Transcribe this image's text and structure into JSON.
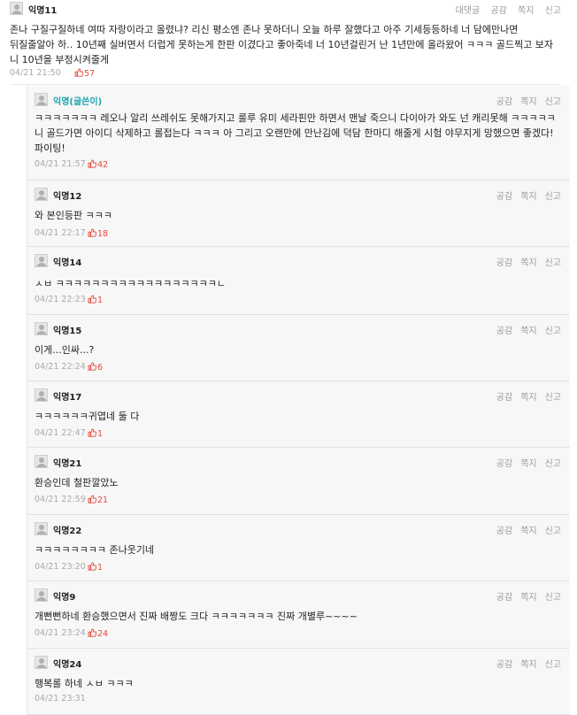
{
  "top_comment": {
    "author": "익명11",
    "actions": [
      "대댓글",
      "공감",
      "쪽지",
      "신고"
    ],
    "text": "존나 구질구질하네 여따 자랑이라고 올렸냐? 리신 평소엔 존나 못하더니 오늘 하루 잘했다고 아주 기세등등하네 너 담에만나면 뒤질줄알아 하.. 10년째 실버면서 더럽게 못하는게 한판 이겼다고 좋아죽네 너 10년걸린거 난 1년만에 올라왔어 ㅋㅋㅋ 골드찍고 보자 니 10년을 부정시켜줄게",
    "time": "04/21 21:50",
    "likes": "57"
  },
  "reply_actions": [
    "공감",
    "쪽지",
    "신고"
  ],
  "replies": [
    {
      "author": "익명(글쓴이)",
      "is_op": true,
      "text": "ㅋㅋㅋㅋㅋㅋㅋ 레오나 알리 쓰레쉬도 못해가지고 룰루 유미 세라핀만 하면서 맨날 죽으니 다이아가 와도 넌 캐리못해 ㅋㅋㅋㅋㅋ 니 골드가면 아이디 삭제하고 롤접는다 ㅋㅋㅋ 아 그리고 오랜만에 만난김에 덕담 한마디 해줄게 시험 야무지게 망했으면 좋겠다! 파이팅!",
      "time": "04/21 21:57",
      "likes": "42"
    },
    {
      "author": "익명12",
      "is_op": false,
      "text": "와 본인등판 ㅋㅋㅋ",
      "time": "04/21 22:17",
      "likes": "18"
    },
    {
      "author": "익명14",
      "is_op": false,
      "text": "ㅅㅂ ㅋㅋㅋㅋㅋㅋㅋㅋㅋㅋㅋㅋㅋㅋㅋㅋㅋㅋㄴ",
      "time": "04/21 22:23",
      "likes": "1"
    },
    {
      "author": "익명15",
      "is_op": false,
      "text": "이게...인싸...?",
      "time": "04/21 22:24",
      "likes": "6"
    },
    {
      "author": "익명17",
      "is_op": false,
      "text": "ㅋㅋㅋㅋㅋㅋ귀엽네 둘 다",
      "time": "04/21 22:47",
      "likes": "1"
    },
    {
      "author": "익명21",
      "is_op": false,
      "text": "환승인데 철판깔았노",
      "time": "04/21 22:59",
      "likes": "21"
    },
    {
      "author": "익명22",
      "is_op": false,
      "text": "ㅋㅋㅋㅋㅋㅋㅋㅋ 존나웃기네",
      "time": "04/21 23:20",
      "likes": "1"
    },
    {
      "author": "익명9",
      "is_op": false,
      "text": "개뻔뻔하네 환승했으면서 진짜 배짱도 크다 ㅋㅋㅋㅋㅋㅋㅋ 진짜 개별루~~~~",
      "time": "04/21 23:24",
      "likes": "24"
    },
    {
      "author": "익명24",
      "is_op": false,
      "text": "행복롤 하네 ㅅㅂ ㅋㅋㅋ",
      "time": "04/21 23:31",
      "likes": ""
    }
  ],
  "colors": {
    "op_name": "#1aa5b0",
    "like": "#e4493c",
    "reply_bg": "#f7f7f7",
    "meta": "#aaaaaa"
  },
  "icons": {
    "avatar": "user-avatar-placeholder",
    "like": "thumbs-up-icon"
  }
}
